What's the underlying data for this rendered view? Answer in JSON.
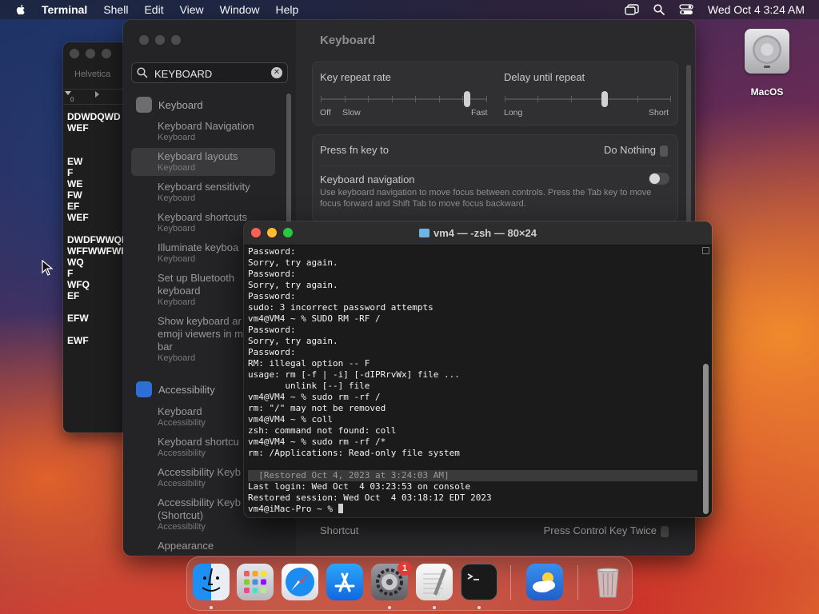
{
  "menubar": {
    "app_name": "Terminal",
    "items": [
      "Shell",
      "Edit",
      "View",
      "Window",
      "Help"
    ],
    "datetime": "Wed Oct 4  3:24 AM"
  },
  "desktop": {
    "disk_label": "MacOS"
  },
  "textedit": {
    "font_label": "Helvetica",
    "ruler_zero": "0",
    "lines": [
      "DDWDQWD",
      "WEF",
      "",
      "",
      "EW",
      "F",
      "WE",
      "FW",
      "EF",
      "WEF",
      "",
      "DWDFWWQI",
      "WFFWWFWI",
      "WQ",
      "F",
      "WFQ",
      "EF",
      "",
      "EFW",
      "",
      "EWF"
    ]
  },
  "settings": {
    "search_value": "KEYBOARD",
    "section_keyboard": "Keyboard",
    "results": [
      {
        "title": "Keyboard Navigation",
        "sub": "Keyboard"
      },
      {
        "title": "Keyboard layouts",
        "sub": "Keyboard",
        "selected": true
      },
      {
        "title": "Keyboard sensitivity",
        "sub": "Keyboard"
      },
      {
        "title": "Keyboard shortcuts",
        "sub": "Keyboard"
      },
      {
        "title": "Illuminate keyboa",
        "sub": "Keyboard"
      },
      {
        "title": "Set up Bluetooth\nkeyboard",
        "sub": "Keyboard"
      },
      {
        "title": "Show keyboard ar\nemoji viewers in m\nbar",
        "sub": "Keyboard"
      }
    ],
    "section_accessibility": "Accessibility",
    "acc_results": [
      {
        "title": "Keyboard",
        "sub": "Accessibility"
      },
      {
        "title": "Keyboard shortcu",
        "sub": "Accessibility"
      },
      {
        "title": "Accessibility Keyb",
        "sub": "Accessibility"
      },
      {
        "title": "Accessibility Keyb\n(Shortcut)",
        "sub": "Accessibility"
      },
      {
        "title": "Appearance",
        "sub": ""
      }
    ],
    "main_title": "Keyboard",
    "key_repeat": {
      "label": "Key repeat rate",
      "left": "Off",
      "left2": "Slow",
      "right": "Fast",
      "level": 0.88
    },
    "delay_repeat": {
      "label": "Delay until repeat",
      "left": "Long",
      "right": "Short",
      "level": 0.6
    },
    "fn_key": {
      "label": "Press fn key to",
      "value": "Do Nothing"
    },
    "kbd_nav": {
      "label": "Keyboard navigation",
      "desc": "Use keyboard navigation to move focus between controls. Press the Tab key to move focus forward and Shift Tab to move focus backward."
    },
    "shortcut": {
      "label": "Shortcut",
      "value": "Press Control Key Twice"
    }
  },
  "terminal": {
    "title": "vm4 — -zsh — 80×24",
    "lines": [
      "Password:",
      "Sorry, try again.",
      "Password:",
      "Sorry, try again.",
      "Password:",
      "sudo: 3 incorrect password attempts",
      "vm4@VM4 ~ % SUDO RM -RF /",
      "Password:",
      "Sorry, try again.",
      "Password:",
      "RM: illegal option -- F",
      "usage: rm [-f | -i] [-dIPRrvWx] file ...",
      "       unlink [--] file",
      "vm4@VM4 ~ % sudo rm -rf /",
      "rm: \"/\" may not be removed",
      "vm4@VM4 ~ % coll",
      "zsh: command not found: coll",
      "vm4@VM4 ~ % sudo rm -rf /*",
      "rm: /Applications: Read-only file system",
      "",
      "  [Restored Oct 4, 2023 at 3:24:03 AM]",
      "Last login: Wed Oct  4 03:23:53 on console",
      "Restored session: Wed Oct  4 03:18:12 EDT 2023",
      "vm4@iMac-Pro ~ % "
    ]
  },
  "dock": {
    "apps": [
      "Finder",
      "Launchpad",
      "Safari",
      "App Store",
      "System Settings",
      "TextEdit",
      "Terminal",
      "Weather",
      "Trash"
    ],
    "settings_badge": "1"
  }
}
